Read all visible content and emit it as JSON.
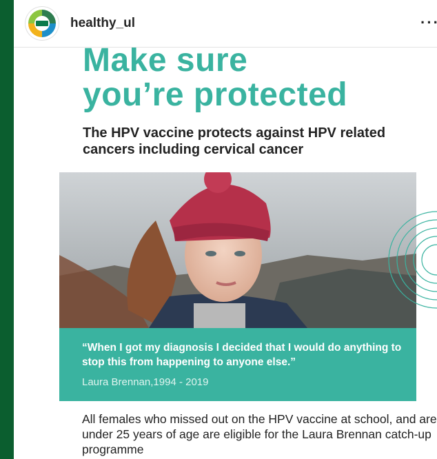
{
  "header": {
    "username": "healthy_ul",
    "more_label": "···",
    "avatar_icon": "hse-logo-icon"
  },
  "post": {
    "headline_line1": "Make sure",
    "headline_line2": "you’re protected",
    "subhead": "The HPV vaccine protects against HPV related cancers including cervical cancer",
    "quote": "“When I got my diagnosis I decided that I would do anything to stop this from happening to anyone else.”",
    "attribution": "Laura Brennan,1994 - 2019",
    "body": "All females who missed out on the HPV vaccine at school, and are under 25 years of age are eligible for the Laura Brennan catch-up programme"
  },
  "colors": {
    "brand_teal": "#3ab3a0",
    "left_strip_green": "#0b5e2f",
    "hat_red": "#b5304a"
  }
}
